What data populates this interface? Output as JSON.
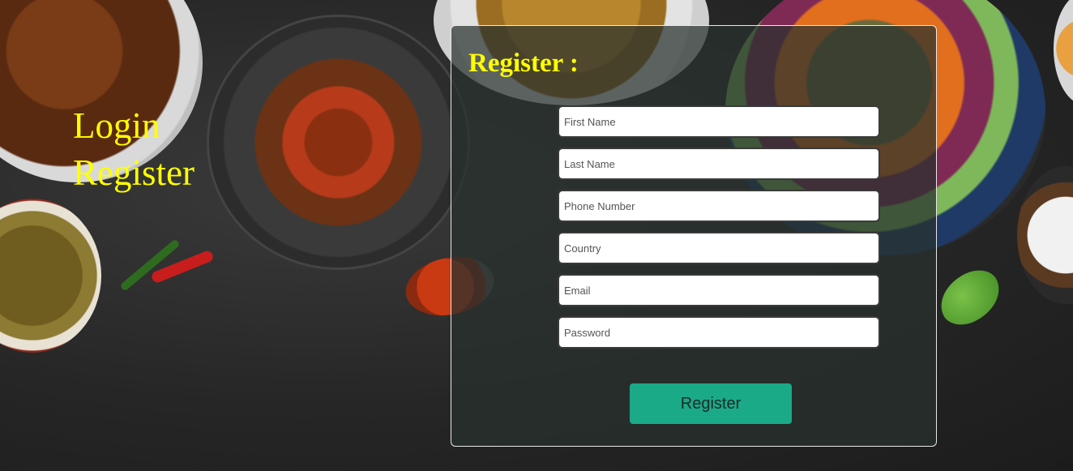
{
  "nav": {
    "login_label": "Login",
    "register_label": "Register"
  },
  "register_form": {
    "title": "Register :",
    "fields": {
      "first_name": {
        "placeholder": "First Name",
        "value": ""
      },
      "last_name": {
        "placeholder": "Last Name",
        "value": ""
      },
      "phone": {
        "placeholder": "Phone Number",
        "value": ""
      },
      "country": {
        "placeholder": "Country",
        "value": ""
      },
      "email": {
        "placeholder": "Email",
        "value": ""
      },
      "password": {
        "placeholder": "Password",
        "value": ""
      }
    },
    "submit_label": "Register"
  },
  "colors": {
    "nav_text": "#ffff00",
    "title_text": "#ffff00",
    "submit_button": "#1aaa88"
  }
}
